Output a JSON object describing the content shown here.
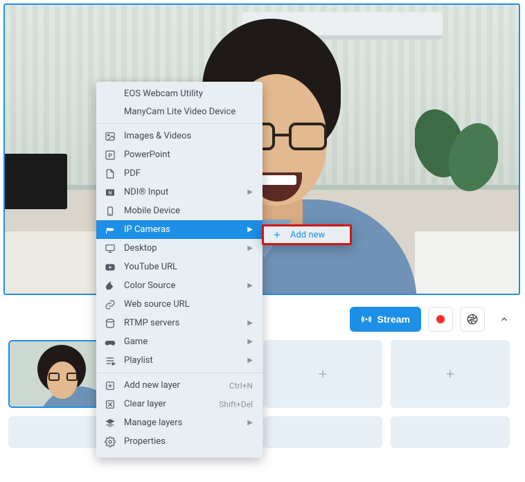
{
  "toolbar": {
    "stream_label": "Stream"
  },
  "context_menu": {
    "header_items": [
      "EOS Webcam Utility",
      "ManyCam Lite Video Device"
    ],
    "items": [
      {
        "id": "images-videos",
        "label": "Images & Videos",
        "icon": "image-icon",
        "submenu": false
      },
      {
        "id": "powerpoint",
        "label": "PowerPoint",
        "icon": "powerpoint-icon",
        "submenu": false
      },
      {
        "id": "pdf",
        "label": "PDF",
        "icon": "pdf-icon",
        "submenu": false
      },
      {
        "id": "ndi-input",
        "label": "NDI® Input",
        "icon": "ndi-icon",
        "submenu": true
      },
      {
        "id": "mobile-device",
        "label": "Mobile Device",
        "icon": "mobile-icon",
        "submenu": false
      },
      {
        "id": "ip-cameras",
        "label": "IP Cameras",
        "icon": "ip-camera-icon",
        "submenu": true,
        "highlight": true
      },
      {
        "id": "desktop",
        "label": "Desktop",
        "icon": "desktop-icon",
        "submenu": true
      },
      {
        "id": "youtube-url",
        "label": "YouTube URL",
        "icon": "youtube-icon",
        "submenu": false
      },
      {
        "id": "color-source",
        "label": "Color Source",
        "icon": "color-icon",
        "submenu": true
      },
      {
        "id": "web-source-url",
        "label": "Web source URL",
        "icon": "link-icon",
        "submenu": false
      },
      {
        "id": "rtmp-servers",
        "label": "RTMP servers",
        "icon": "rtmp-icon",
        "submenu": true
      },
      {
        "id": "game",
        "label": "Game",
        "icon": "game-icon",
        "submenu": true
      },
      {
        "id": "playlist",
        "label": "Playlist",
        "icon": "playlist-icon",
        "submenu": true
      }
    ],
    "layer_items": [
      {
        "id": "add-new-layer",
        "label": "Add new layer",
        "icon": "add-layer-icon",
        "shortcut": "Ctrl+N"
      },
      {
        "id": "clear-layer",
        "label": "Clear layer",
        "icon": "clear-layer-icon",
        "shortcut": "Shift+Del"
      },
      {
        "id": "manage-layers",
        "label": "Manage layers",
        "icon": "manage-layers-icon",
        "submenu": true
      },
      {
        "id": "properties",
        "label": "Properties",
        "icon": "properties-icon"
      }
    ]
  },
  "submenu": {
    "add_new_label": "Add new"
  }
}
